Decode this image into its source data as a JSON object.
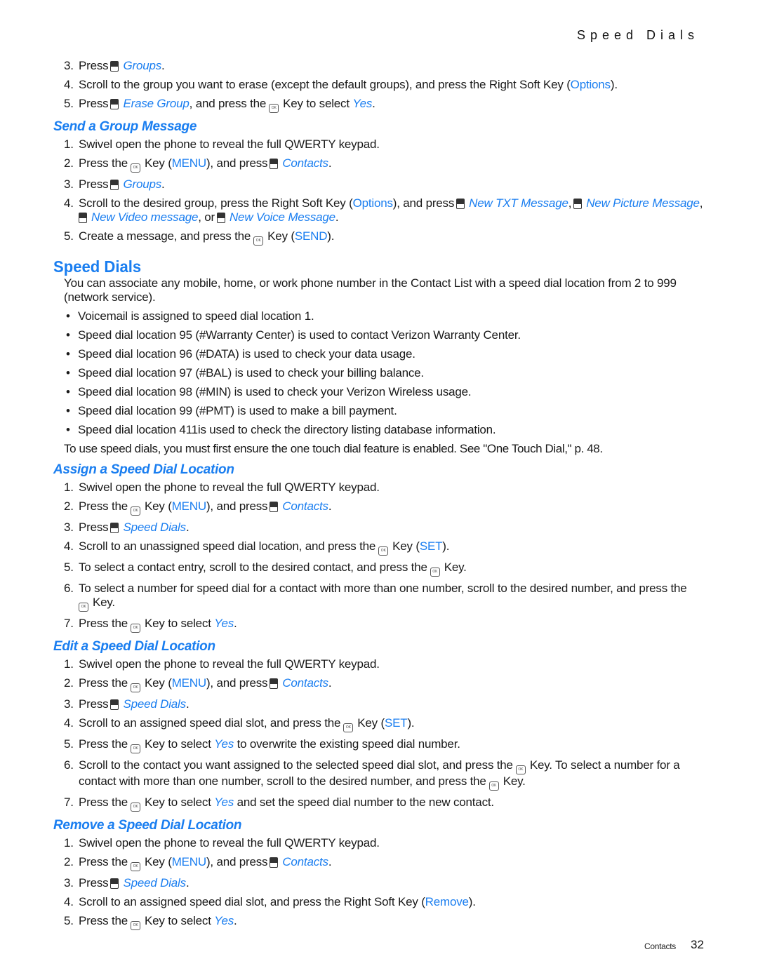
{
  "running_head": "Speed Dials",
  "icons": {
    "number_key": "numeric-key-icon",
    "ok_key": "ok-key-icon"
  },
  "colors": {
    "link": "#1a7ef0",
    "text": "#1a1a1a"
  },
  "erase_group_steps": [
    {
      "num": "3.",
      "a": "Press",
      "b": "Groups",
      "c": "."
    },
    {
      "num": "4.",
      "a": "Scroll to the group you want to erase (except the default groups), and press the Right Soft Key (",
      "b": "Options",
      "c": ")."
    },
    {
      "num": "5.",
      "a": "Press",
      "b": "Erase Group",
      "c": ", and press the",
      "d": "Key to select",
      "e": "Yes",
      "f": "."
    }
  ],
  "send_group": {
    "heading": "Send a Group Message",
    "steps": [
      {
        "num": "1.",
        "a": "Swivel open the phone to reveal the full QWERTY keypad."
      },
      {
        "num": "2.",
        "a": "Press the",
        "b": "Key (",
        "c": "MENU",
        "d": "), and press",
        "e": "Contacts",
        "f": "."
      },
      {
        "num": "3.",
        "a": "Press",
        "b": "Groups",
        "c": "."
      },
      {
        "num": "4.",
        "a": "Scroll to the desired group, press the Right Soft Key (",
        "b": "Options",
        "c": "), and press",
        "d": "New TXT Message",
        "e": ",",
        "f": "New Picture Message",
        "g": ",",
        "h": "New Video message",
        "i": ", or",
        "j": "New Voice Message",
        "k": "."
      },
      {
        "num": "5.",
        "a": "Create a message, and press the",
        "b": "Key (",
        "c": "SEND",
        "d": ")."
      }
    ]
  },
  "speed_dials": {
    "heading": "Speed Dials",
    "intro": "You can associate any mobile, home, or work phone number in the Contact List with a speed dial location from 2 to 999 (network service).",
    "bullets": [
      "Voicemail is assigned to speed dial location 1.",
      "Speed dial location 95 (#Warranty Center) is used to contact Verizon Warranty Center.",
      "Speed dial location 96 (#DATA) is used to check your data usage.",
      "Speed dial location 97 (#BAL) is used to check your billing balance.",
      "Speed dial location 98 (#MIN) is used to check your Verizon Wireless usage.",
      "Speed dial location 99 (#PMT) is used to make a bill payment.",
      "Speed dial location 411is used to check the directory listing database information."
    ],
    "note": "To use speed dials, you must first ensure the one touch dial feature is enabled. See \"One Touch Dial,\" p. 48."
  },
  "assign": {
    "heading": "Assign a Speed Dial Location",
    "steps": [
      {
        "num": "1.",
        "a": "Swivel open the phone to reveal the full QWERTY keypad."
      },
      {
        "num": "2.",
        "a": "Press the",
        "b": "Key (",
        "c": "MENU",
        "d": "), and press",
        "e": "Contacts",
        "f": "."
      },
      {
        "num": "3.",
        "a": "Press",
        "b": "Speed Dials",
        "c": "."
      },
      {
        "num": "4.",
        "a": "Scroll to an unassigned speed dial location, and press the",
        "b": "Key (",
        "c": "SET",
        "d": ")."
      },
      {
        "num": "5.",
        "a": "To select a contact entry, scroll to the desired contact, and press the",
        "b": "Key."
      },
      {
        "num": "6.",
        "a": "To select a number for speed dial for a contact with more than one number, scroll to the desired number, and press the",
        "b": "Key."
      },
      {
        "num": "7.",
        "a": "Press the",
        "b": "Key to select",
        "c": "Yes",
        "d": "."
      }
    ]
  },
  "edit": {
    "heading": "Edit a Speed Dial Location",
    "steps": [
      {
        "num": "1.",
        "a": "Swivel open the phone to reveal the full QWERTY keypad."
      },
      {
        "num": "2.",
        "a": "Press the",
        "b": "Key (",
        "c": "MENU",
        "d": "), and press",
        "e": "Contacts",
        "f": "."
      },
      {
        "num": "3.",
        "a": "Press",
        "b": "Speed Dials",
        "c": "."
      },
      {
        "num": "4.",
        "a": "Scroll to an assigned speed dial slot, and press the",
        "b": "Key (",
        "c": "SET",
        "d": ")."
      },
      {
        "num": "5.",
        "a": "Press the",
        "b": "Key to select",
        "c": "Yes",
        "d": "to overwrite the existing speed dial number."
      },
      {
        "num": "6.",
        "a": "Scroll to the contact you want assigned to the selected speed dial slot, and press the",
        "b": "Key. To select a number for a contact with more than one number, scroll to the desired number, and press the",
        "c": "Key."
      },
      {
        "num": "7.",
        "a": "Press the",
        "b": "Key to select",
        "c": "Yes",
        "d": "and set the speed dial number to the new contact."
      }
    ]
  },
  "remove": {
    "heading": "Remove a Speed Dial Location",
    "steps": [
      {
        "num": "1.",
        "a": "Swivel open the phone to reveal the full QWERTY keypad."
      },
      {
        "num": "2.",
        "a": "Press the",
        "b": "Key (",
        "c": "MENU",
        "d": "), and press",
        "e": "Contacts",
        "f": "."
      },
      {
        "num": "3.",
        "a": "Press",
        "b": "Speed Dials",
        "c": "."
      },
      {
        "num": "4.",
        "a": "Scroll to an assigned speed dial slot, and press the Right Soft Key (",
        "b": "Remove",
        "c": ")."
      },
      {
        "num": "5.",
        "a": "Press the",
        "b": "Key to select",
        "c": "Yes",
        "d": "."
      }
    ]
  },
  "footer": {
    "section": "Contacts",
    "page": "32"
  }
}
